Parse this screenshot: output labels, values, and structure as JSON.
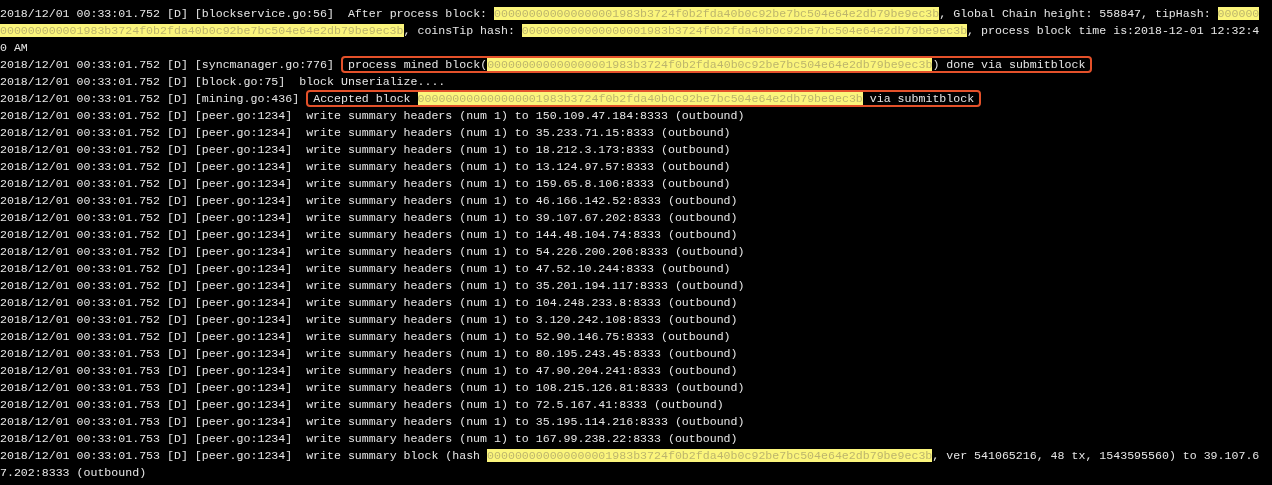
{
  "log_lines": [
    {
      "prefix": "2018/12/01 00:33:01.752 [D] [blockservice.go:56]",
      "framed": false,
      "message": [
        {
          "kind": "text",
          "text": " After process block: "
        },
        {
          "kind": "hash",
          "text": "000000000000000001983b3724f0b2fda40b0c92be7bc504e64e2db79be9ec3b"
        },
        {
          "kind": "text",
          "text": ", Global Chain height: 558847, tipHash: "
        },
        {
          "kind": "hash",
          "text": "000000000000000001983b3724f0b2fda40b0c92be7bc504e64e2db79be9ec3b"
        },
        {
          "kind": "text",
          "text": ", coinsTip hash: "
        },
        {
          "kind": "hash",
          "text": "000000000000000001983b3724f0b2fda40b0c92be7bc504e64e2db79be9ec3b"
        },
        {
          "kind": "text",
          "text": ", process block time is:2018-12-01 12:32:40 AM"
        }
      ]
    },
    {
      "prefix": "2018/12/01 00:33:01.752 [D] [syncmanager.go:776]",
      "framed": true,
      "message": [
        {
          "kind": "text",
          "text": "process mined block("
        },
        {
          "kind": "hash",
          "text": "000000000000000001983b3724f0b2fda40b0c92be7bc504e64e2db79be9ec3b"
        },
        {
          "kind": "text",
          "text": ") done via submitblock"
        }
      ]
    },
    {
      "prefix": "2018/12/01 00:33:01.752 [D] [block.go:75]",
      "framed": false,
      "message": [
        {
          "kind": "text",
          "text": " block Unserialize...."
        }
      ]
    },
    {
      "prefix": "2018/12/01 00:33:01.752 [D] [mining.go:436]",
      "framed": true,
      "message": [
        {
          "kind": "text",
          "text": "Accepted block "
        },
        {
          "kind": "hash",
          "text": "000000000000000001983b3724f0b2fda40b0c92be7bc504e64e2db79be9ec3b"
        },
        {
          "kind": "text",
          "text": " via submitblock"
        }
      ]
    },
    {
      "prefix": "2018/12/01 00:33:01.752 [D] [peer.go:1234]",
      "framed": false,
      "message": [
        {
          "kind": "text",
          "text": " write summary headers (num 1) to 150.109.47.184:8333 (outbound)"
        }
      ]
    },
    {
      "prefix": "2018/12/01 00:33:01.752 [D] [peer.go:1234]",
      "framed": false,
      "message": [
        {
          "kind": "text",
          "text": " write summary headers (num 1) to 35.233.71.15:8333 (outbound)"
        }
      ]
    },
    {
      "prefix": "2018/12/01 00:33:01.752 [D] [peer.go:1234]",
      "framed": false,
      "message": [
        {
          "kind": "text",
          "text": " write summary headers (num 1) to 18.212.3.173:8333 (outbound)"
        }
      ]
    },
    {
      "prefix": "2018/12/01 00:33:01.752 [D] [peer.go:1234]",
      "framed": false,
      "message": [
        {
          "kind": "text",
          "text": " write summary headers (num 1) to 13.124.97.57:8333 (outbound)"
        }
      ]
    },
    {
      "prefix": "2018/12/01 00:33:01.752 [D] [peer.go:1234]",
      "framed": false,
      "message": [
        {
          "kind": "text",
          "text": " write summary headers (num 1) to 159.65.8.106:8333 (outbound)"
        }
      ]
    },
    {
      "prefix": "2018/12/01 00:33:01.752 [D] [peer.go:1234]",
      "framed": false,
      "message": [
        {
          "kind": "text",
          "text": " write summary headers (num 1) to 46.166.142.52:8333 (outbound)"
        }
      ]
    },
    {
      "prefix": "2018/12/01 00:33:01.752 [D] [peer.go:1234]",
      "framed": false,
      "message": [
        {
          "kind": "text",
          "text": " write summary headers (num 1) to 39.107.67.202:8333 (outbound)"
        }
      ]
    },
    {
      "prefix": "2018/12/01 00:33:01.752 [D] [peer.go:1234]",
      "framed": false,
      "message": [
        {
          "kind": "text",
          "text": " write summary headers (num 1) to 144.48.104.74:8333 (outbound)"
        }
      ]
    },
    {
      "prefix": "2018/12/01 00:33:01.752 [D] [peer.go:1234]",
      "framed": false,
      "message": [
        {
          "kind": "text",
          "text": " write summary headers (num 1) to 54.226.200.206:8333 (outbound)"
        }
      ]
    },
    {
      "prefix": "2018/12/01 00:33:01.752 [D] [peer.go:1234]",
      "framed": false,
      "message": [
        {
          "kind": "text",
          "text": " write summary headers (num 1) to 47.52.10.244:8333 (outbound)"
        }
      ]
    },
    {
      "prefix": "2018/12/01 00:33:01.752 [D] [peer.go:1234]",
      "framed": false,
      "message": [
        {
          "kind": "text",
          "text": " write summary headers (num 1) to 35.201.194.117:8333 (outbound)"
        }
      ]
    },
    {
      "prefix": "2018/12/01 00:33:01.752 [D] [peer.go:1234]",
      "framed": false,
      "message": [
        {
          "kind": "text",
          "text": " write summary headers (num 1) to 104.248.233.8:8333 (outbound)"
        }
      ]
    },
    {
      "prefix": "2018/12/01 00:33:01.752 [D] [peer.go:1234]",
      "framed": false,
      "message": [
        {
          "kind": "text",
          "text": " write summary headers (num 1) to 3.120.242.108:8333 (outbound)"
        }
      ]
    },
    {
      "prefix": "2018/12/01 00:33:01.752 [D] [peer.go:1234]",
      "framed": false,
      "message": [
        {
          "kind": "text",
          "text": " write summary headers (num 1) to 52.90.146.75:8333 (outbound)"
        }
      ]
    },
    {
      "prefix": "2018/12/01 00:33:01.753 [D] [peer.go:1234]",
      "framed": false,
      "message": [
        {
          "kind": "text",
          "text": " write summary headers (num 1) to 80.195.243.45:8333 (outbound)"
        }
      ]
    },
    {
      "prefix": "2018/12/01 00:33:01.753 [D] [peer.go:1234]",
      "framed": false,
      "message": [
        {
          "kind": "text",
          "text": " write summary headers (num 1) to 47.90.204.241:8333 (outbound)"
        }
      ]
    },
    {
      "prefix": "2018/12/01 00:33:01.753 [D] [peer.go:1234]",
      "framed": false,
      "message": [
        {
          "kind": "text",
          "text": " write summary headers (num 1) to 108.215.126.81:8333 (outbound)"
        }
      ]
    },
    {
      "prefix": "2018/12/01 00:33:01.753 [D] [peer.go:1234]",
      "framed": false,
      "message": [
        {
          "kind": "text",
          "text": " write summary headers (num 1) to 72.5.167.41:8333 (outbound)"
        }
      ]
    },
    {
      "prefix": "2018/12/01 00:33:01.753 [D] [peer.go:1234]",
      "framed": false,
      "message": [
        {
          "kind": "text",
          "text": " write summary headers (num 1) to 35.195.114.216:8333 (outbound)"
        }
      ]
    },
    {
      "prefix": "2018/12/01 00:33:01.753 [D] [peer.go:1234]",
      "framed": false,
      "message": [
        {
          "kind": "text",
          "text": " write summary headers (num 1) to 167.99.238.22:8333 (outbound)"
        }
      ]
    },
    {
      "prefix": "2018/12/01 00:33:01.753 [D] [peer.go:1234]",
      "framed": false,
      "message": [
        {
          "kind": "text",
          "text": " write summary block (hash "
        },
        {
          "kind": "hash",
          "text": "000000000000000001983b3724f0b2fda40b0c92be7bc504e64e2db79be9ec3b"
        },
        {
          "kind": "text",
          "text": ", ver 541065216, 48 tx, 1543595560) to 39.107.67.202:8333 (outbound)"
        }
      ]
    }
  ]
}
